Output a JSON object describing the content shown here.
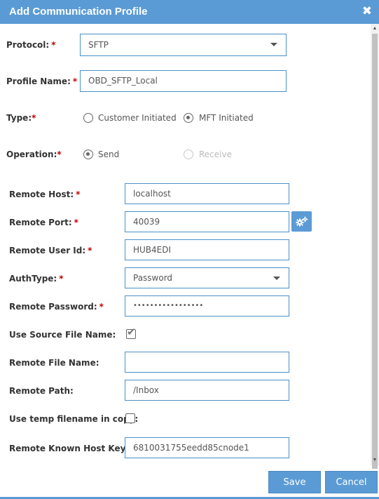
{
  "dialog": {
    "title": "Add Communication Profile"
  },
  "fields": {
    "protocol": {
      "label": "Protocol:",
      "value": "SFTP"
    },
    "profile_name": {
      "label": "Profile Name:",
      "value": "OBD_SFTP_Local"
    },
    "type": {
      "label": "Type:",
      "options": [
        "Customer Initiated",
        "MFT Initiated"
      ],
      "selected": "MFT Initiated"
    },
    "operation": {
      "label": "Operation:",
      "options": [
        "Send",
        "Receive"
      ],
      "selected": "Send",
      "disabled": [
        "Receive"
      ]
    },
    "remote_host": {
      "label": "Remote Host:",
      "value": "localhost"
    },
    "remote_port": {
      "label": "Remote Port:",
      "value": "40039"
    },
    "remote_user_id": {
      "label": "Remote User Id:",
      "value": "HUB4EDI"
    },
    "auth_type": {
      "label": "AuthType:",
      "value": "Password"
    },
    "remote_password": {
      "label": "Remote Password:",
      "value": "•••••••••••••••••"
    },
    "use_source_file_name": {
      "label": "Use Source File Name:",
      "checked": true
    },
    "remote_file_name": {
      "label": "Remote File Name:",
      "value": ""
    },
    "remote_path": {
      "label": "Remote Path:",
      "value": "/Inbox"
    },
    "use_temp_filename": {
      "label": "Use temp filename in copy:",
      "checked": false
    },
    "remote_known_host_key": {
      "label": "Remote Known Host Key:",
      "value": "6810031755eedd85cnode1"
    }
  },
  "required_marker": "*",
  "buttons": {
    "save": "Save",
    "cancel": "Cancel"
  },
  "icons": {
    "close": "close-icon",
    "gear": "gears-icon"
  },
  "colors": {
    "accent": "#5b9bd5",
    "border": "#4a90c8",
    "required": "#c00000"
  }
}
